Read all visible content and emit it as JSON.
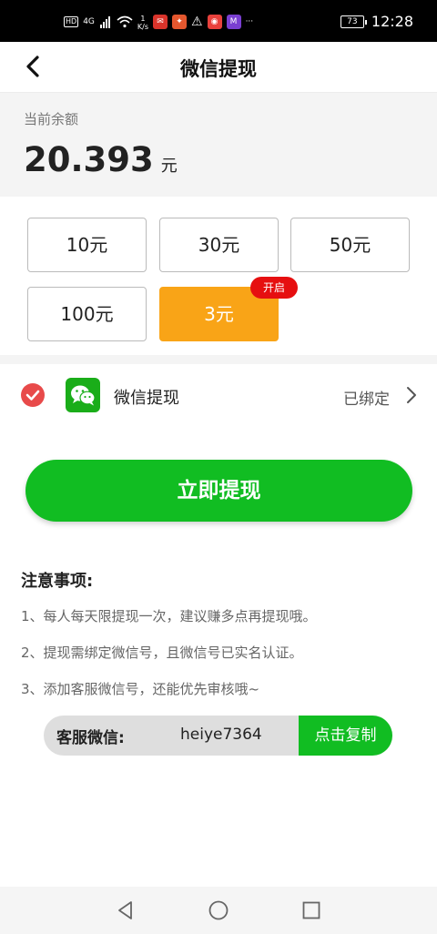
{
  "status_bar": {
    "network_label": "4G",
    "speed_value": "1",
    "speed_unit": "K/s",
    "overflow": "···",
    "battery": "73",
    "time": "12:28"
  },
  "header": {
    "title": "微信提现"
  },
  "balance": {
    "label": "当前余额",
    "amount": "20.393",
    "unit": "元"
  },
  "amounts": [
    {
      "label": "10元"
    },
    {
      "label": "30元"
    },
    {
      "label": "50元"
    },
    {
      "label": "100元"
    },
    {
      "label": "3元",
      "badge": "开启",
      "selected": true
    }
  ],
  "payment_method": {
    "name": "微信提现",
    "status": "已绑定"
  },
  "withdraw_button": "立即提现",
  "notes": {
    "title": "注意事项:",
    "items": [
      "1、每人每天限提现一次，建议赚多点再提现哦。",
      "2、提现需绑定微信号，且微信号已实名认证。",
      "3、添加客服微信号，还能优先审核哦~"
    ]
  },
  "service": {
    "label": "客服微信:",
    "wechat_id": "heiye7364",
    "copy_label": "点击复制"
  },
  "colors": {
    "primary_green": "#11bd22",
    "selected_orange": "#f9a417",
    "badge_red": "#e60f10",
    "check_red": "#e84a4a"
  }
}
